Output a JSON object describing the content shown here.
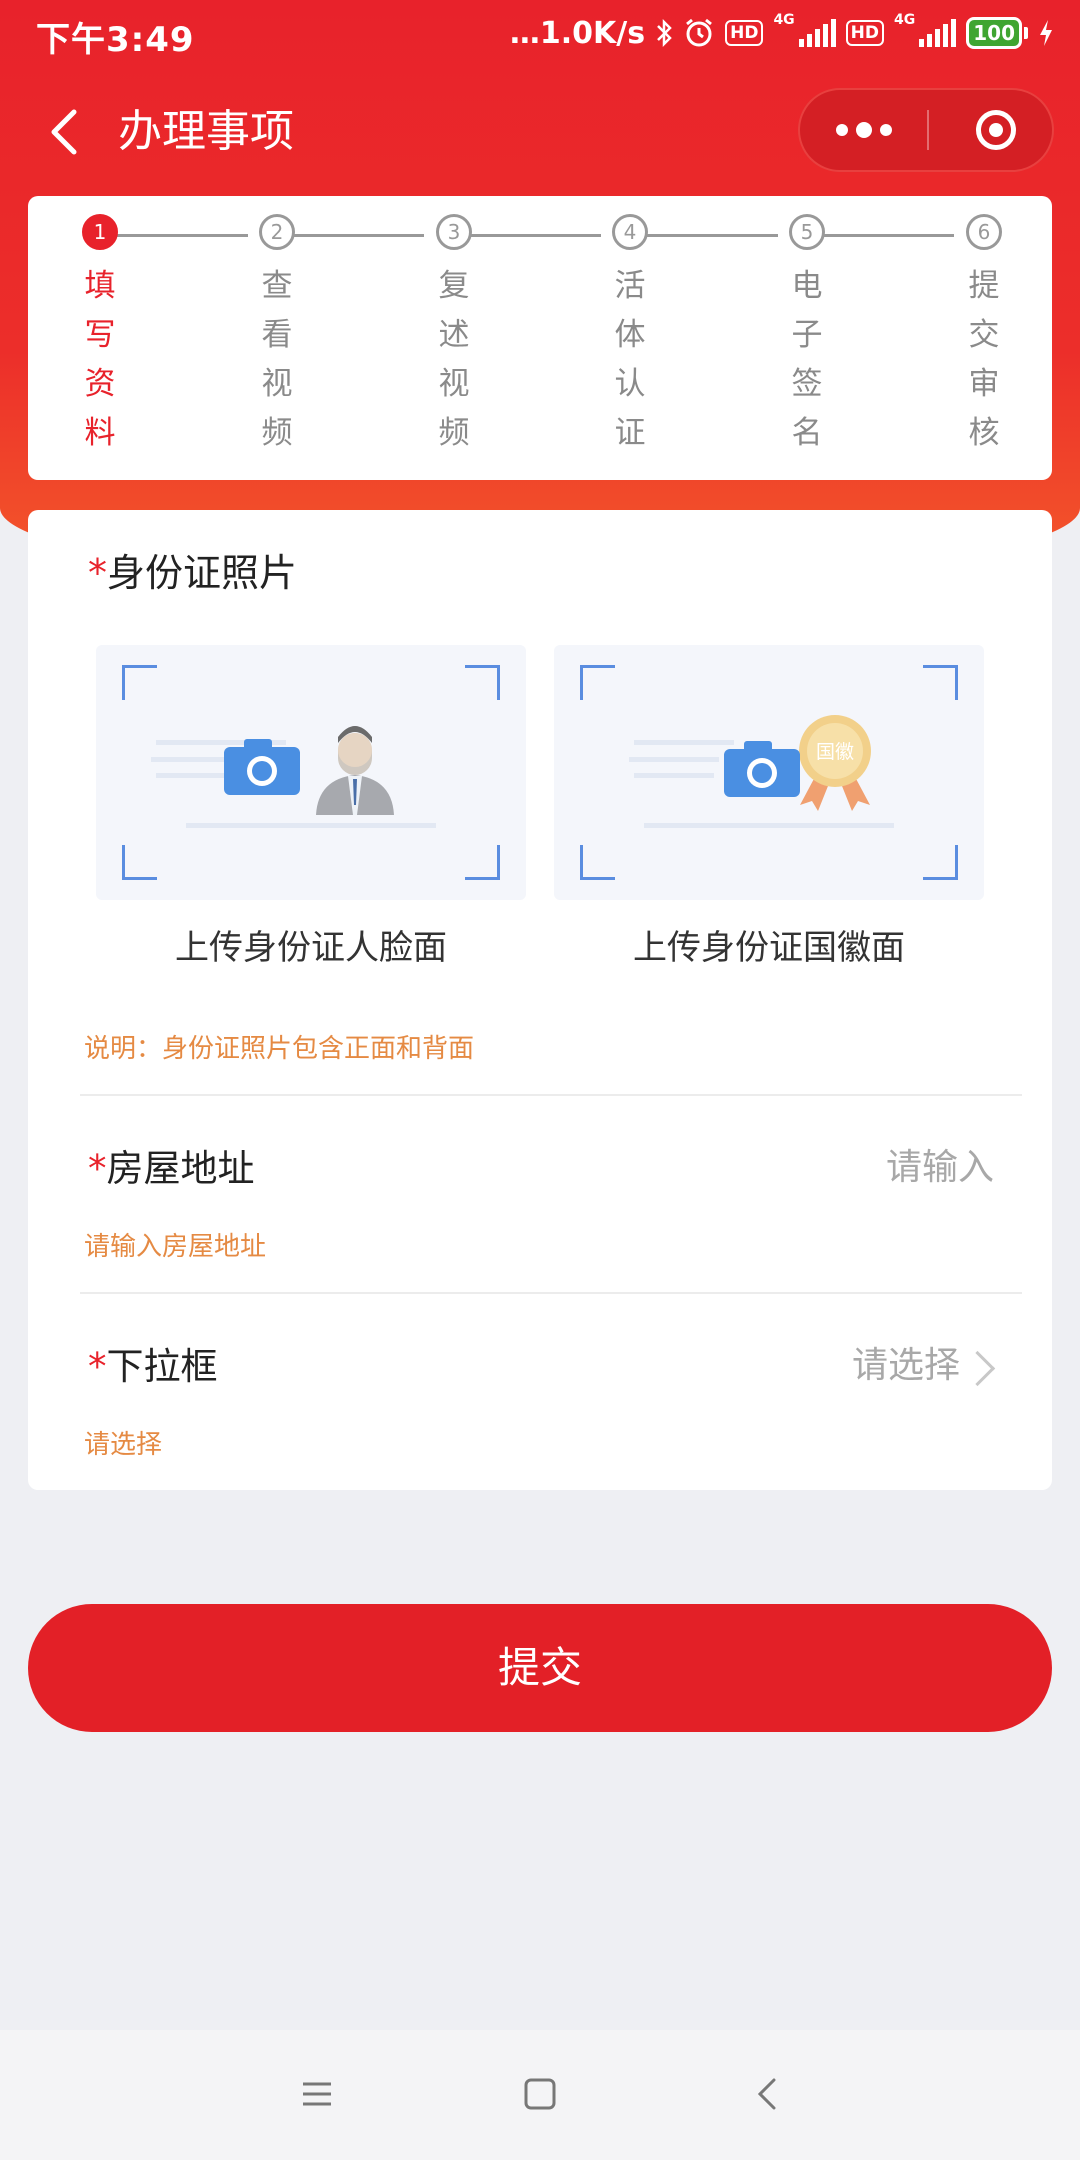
{
  "status_bar": {
    "time": "下午3:49",
    "speed": "…1.0K/s",
    "hd1": "HD",
    "hd2": "HD",
    "net1": "4G",
    "net2": "4G",
    "battery": "100"
  },
  "nav": {
    "title": "办理事项"
  },
  "steps": [
    {
      "num": "1",
      "label": "填写资料",
      "active": true
    },
    {
      "num": "2",
      "label": "查看视频",
      "active": false
    },
    {
      "num": "3",
      "label": "复述视频",
      "active": false
    },
    {
      "num": "4",
      "label": "活体认证",
      "active": false
    },
    {
      "num": "5",
      "label": "电子签名",
      "active": false
    },
    {
      "num": "6",
      "label": "提交审核",
      "active": false
    }
  ],
  "form": {
    "required_mark": "*",
    "id_photo": {
      "title": "身份证照片",
      "front_label": "上传身份证人脸面",
      "back_label": "上传身份证国徽面",
      "emblem_text": "国徽",
      "note": "说明：身份证照片包含正面和背面"
    },
    "address": {
      "label": "房屋地址",
      "placeholder": "请输入",
      "hint": "请输入房屋地址"
    },
    "dropdown": {
      "label": "下拉框",
      "placeholder": "请选择",
      "hint": "请选择"
    }
  },
  "submit_label": "提交",
  "colors": {
    "primary": "#e32027",
    "hint": "#e58a43",
    "inactive": "#999999"
  }
}
